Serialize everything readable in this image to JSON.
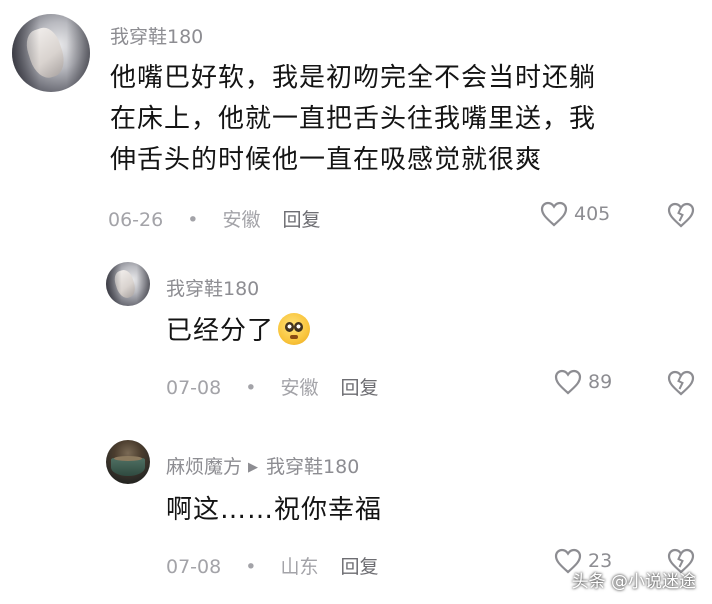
{
  "comments": [
    {
      "author": "我穿鞋180",
      "lines": [
        "他嘴巴好软，我是初吻完全不会当时还躺",
        "在床上，他就一直把舌头往我嘴里送，我",
        "伸舌头的时候他一直在吸感觉就很爽"
      ],
      "date": "06-26",
      "separator": "•",
      "location": "安徽",
      "reply_label": "回复",
      "likes": "405"
    },
    {
      "author": "我穿鞋180",
      "text": "已经分了",
      "emoji": "pleading-face-icon",
      "date": "07-08",
      "separator": "•",
      "location": "安徽",
      "reply_label": "回复",
      "likes": "89"
    },
    {
      "author": "麻烦魔方",
      "reply_arrow": "▶",
      "reply_to": "我穿鞋180",
      "text": "啊这……祝你幸福",
      "date": "07-08",
      "separator": "•",
      "location": "山东",
      "reply_label": "回复",
      "likes": "23"
    }
  ],
  "watermark": "头条 @小说迷途",
  "colors": {
    "meta_gray": "#a3a3a8",
    "author_gray": "#8d8d92",
    "text_dark": "#141414"
  }
}
